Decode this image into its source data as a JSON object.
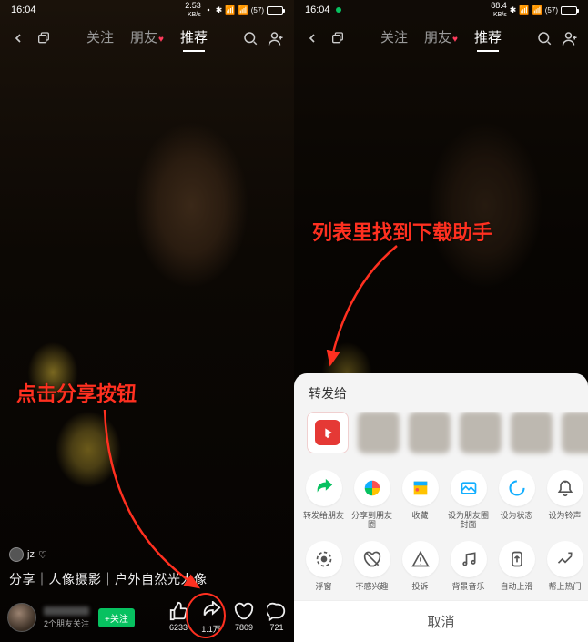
{
  "status": {
    "time": "16:04",
    "kbps_left": "2.53",
    "kbps_right": "88.4",
    "kbps_unit": "KB/s",
    "battery_pct": "57"
  },
  "topnav": {
    "tabs": [
      "关注",
      "朋友",
      "推荐"
    ],
    "active_index": 2
  },
  "left": {
    "annotation": "点击分享按钮",
    "author_name": "jz",
    "caption": "分享｜人像摄影｜户外自然光人像",
    "user_sub": "2个朋友关注",
    "follow": "+关注",
    "actions": {
      "like": "6233",
      "share": "1.1万",
      "fav": "7809",
      "comment": "721"
    }
  },
  "right": {
    "annotation": "列表里找到下载助手",
    "sheet_title": "转发给",
    "row1": [
      {
        "label": "转发给朋友"
      },
      {
        "label": "分享到朋友圈"
      },
      {
        "label": "收藏"
      },
      {
        "label": "设为朋友圈封面"
      },
      {
        "label": "设为状态"
      },
      {
        "label": "设为铃声"
      }
    ],
    "row2": [
      {
        "label": "浮窗"
      },
      {
        "label": "不感兴趣"
      },
      {
        "label": "投诉"
      },
      {
        "label": "背景音乐"
      },
      {
        "label": "自动上滑"
      },
      {
        "label": "帮上热门"
      }
    ],
    "cancel": "取消"
  }
}
